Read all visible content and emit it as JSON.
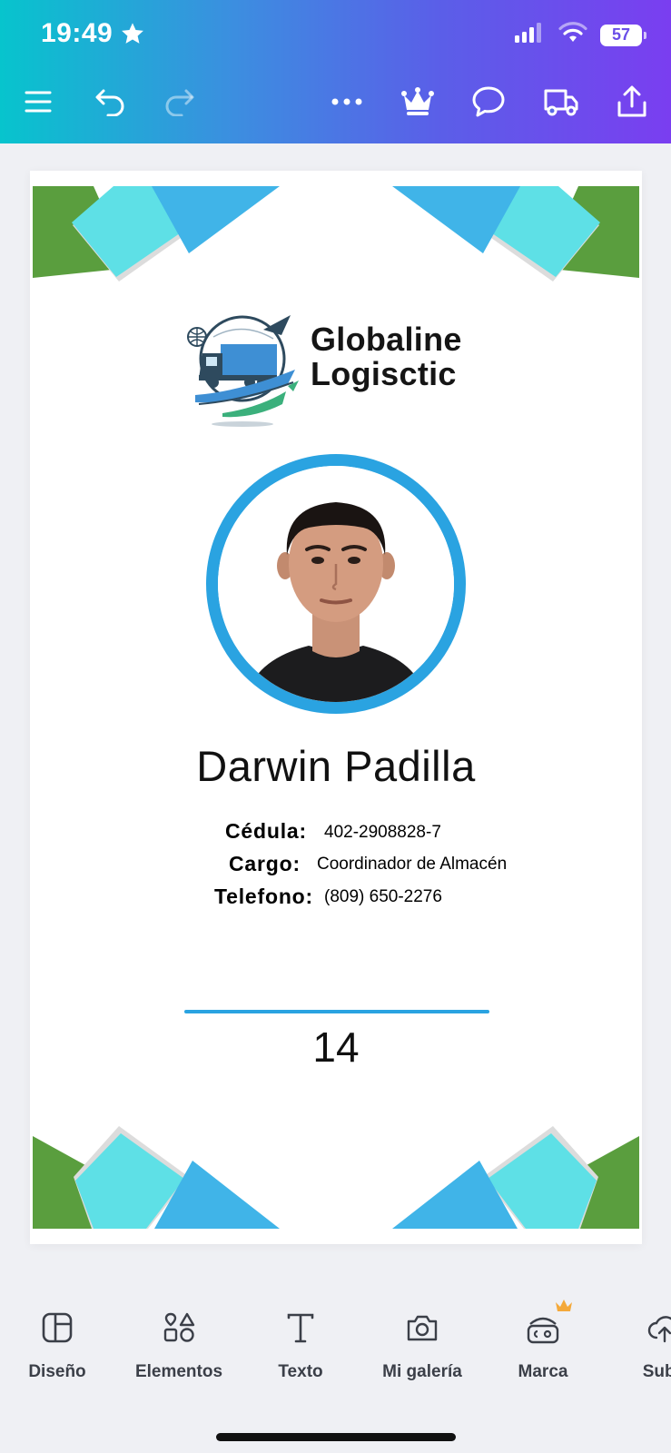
{
  "status_bar": {
    "time": "19:49",
    "battery": "57",
    "icons": [
      "star-icon",
      "signal-icon",
      "wifi-icon",
      "battery-icon"
    ]
  },
  "toolbar": {
    "icons": [
      "menu-icon",
      "undo-icon",
      "redo-icon",
      "more-icon",
      "crown-icon",
      "comment-icon",
      "truck-icon",
      "share-icon"
    ]
  },
  "card": {
    "company_line1": "Globaline",
    "company_line2": "Logisctic",
    "person_name": "Darwin Padilla",
    "fields": {
      "cedula_label": "Cédula:",
      "cedula_value": "402-2908828-7",
      "cargo_label": "Cargo:",
      "cargo_value": "Coordinador de Almacén",
      "telefono_label": "Telefono:",
      "telefono_value": "(809) 650-2276"
    },
    "number": "14"
  },
  "colors": {
    "accent_blue": "#2aa3e1",
    "light_cyan": "#5ee0e6",
    "sky_blue": "#40b4e8",
    "green": "#5a9e3e"
  },
  "bottom_tools": {
    "diseno": "Diseño",
    "elementos": "Elementos",
    "texto": "Texto",
    "galeria": "Mi galería",
    "marca": "Marca",
    "subir": "Subir"
  }
}
